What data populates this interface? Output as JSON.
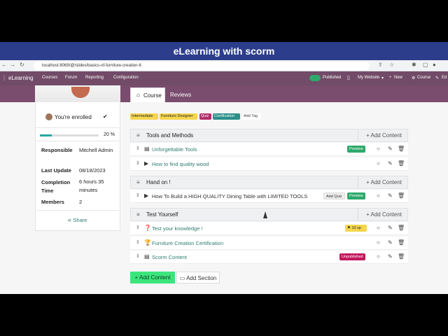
{
  "banner": {
    "title": "eLearning with scorm"
  },
  "browser": {
    "url": "localhost:8069/@/slides/basics-of-furniture-creation-6"
  },
  "nav": {
    "brand": "eLearning",
    "menu": [
      "Courses",
      "Forum",
      "Reporting",
      "Configuration"
    ],
    "published": "Published",
    "website": "My Website",
    "new": "New",
    "course": "Course",
    "edit": "Ed"
  },
  "sidebar": {
    "enrolled": "You're enrolled",
    "check": "✔",
    "progress_text": "20 %",
    "progress_fraction": 0.2,
    "responsible_label": "Responsible",
    "responsible": "Mitchell Admin",
    "last_update_label": "Last Update",
    "last_update": "08/18/2023",
    "completion_label": "Completion Time",
    "completion": "6 hours 35 minutes",
    "members_label": "Members",
    "members": "2",
    "share": "Share"
  },
  "tabs": {
    "course": "Course",
    "reviews": "Reviews"
  },
  "tags": [
    "Intermediate",
    "Furniture Designer",
    "Quiz",
    "Certification"
  ],
  "tag_colors": [
    "#f5d64f",
    "#f5d64f",
    "#b0306a",
    "#2b8f8a"
  ],
  "add_tag": "Add Tag",
  "add_content": "Add Content",
  "sections": [
    {
      "title": "Tools and Methods"
    },
    {
      "title": "Hand on !"
    },
    {
      "title": "Test Yourself"
    }
  ],
  "rows": [
    {
      "label": "Unforgettable Tools",
      "icon": "file-icon",
      "badge": "Preview"
    },
    {
      "label": "How to find quality wood",
      "icon": "video-icon",
      "badge": ""
    },
    {
      "label": "How To Build a HIGH QUALITY Dining Table with LIMITED TOOLS",
      "icon": "video-icon",
      "badge": "Preview",
      "extra": "Add Quiz"
    },
    {
      "label": "Test your knowledge !",
      "icon": "question-icon",
      "badge": "10 xp"
    },
    {
      "label": "Furniture Creation Certification",
      "icon": "trophy-icon",
      "badge": ""
    },
    {
      "label": "Scorm Content",
      "icon": "file-icon",
      "badge": "Unpublished"
    }
  ],
  "buttons": {
    "add_content": "Add Content",
    "add_section": "Add Section"
  }
}
